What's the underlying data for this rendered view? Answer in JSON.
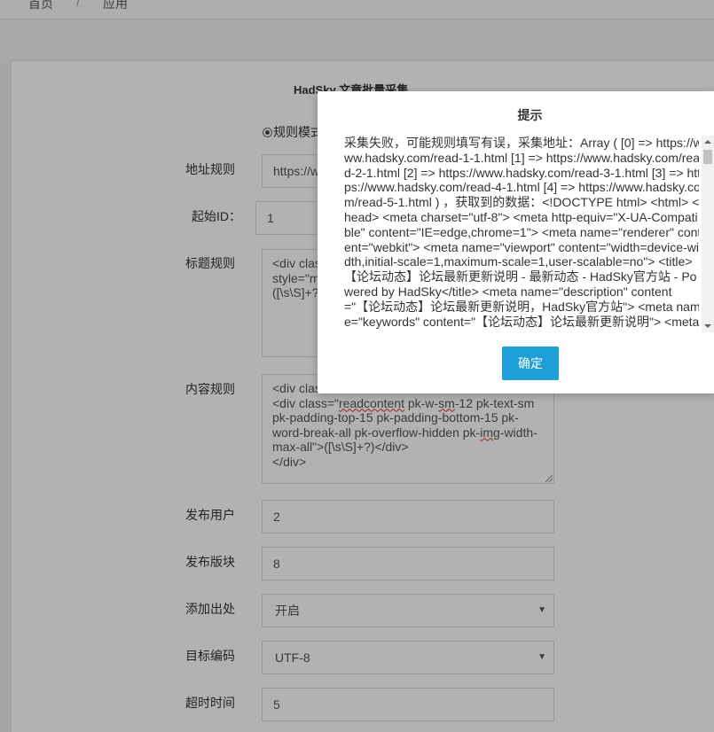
{
  "breadcrumb": {
    "home": "首页",
    "separator": "/",
    "current": "应用"
  },
  "form": {
    "title": "HadSky 文章批量采集",
    "mode_label": "规则模式",
    "url_rule": {
      "label": "地址规则",
      "value": "https://www.hadsky.com/read-{id}-1.html"
    },
    "start_id": {
      "label": "起始ID：",
      "value": "1"
    },
    "title_rule": {
      "label": "标题规则",
      "value": "<div class=\"title\"\nstyle=\"m\n([\\s\\S]+?)"
    },
    "content_rule": {
      "label": "内容规则",
      "line1": "<div class",
      "line2_pre": "<div class=\"",
      "line2_err1": "readcontent",
      "line2_mid": " pk-w-",
      "line2_err2": "sm",
      "line2_post": "-12 pk-text-sm",
      "line3": "pk-padding-top-15 pk-padding-bottom-15 pk-",
      "line4_pre": "word-break-all pk-overflow-hidden pk-",
      "line4_err": "img",
      "line4_post": "-width-",
      "line5": "max-all\">([\\s\\S]+?)</div>",
      "line6": "</div>"
    },
    "publish_user": {
      "label": "发布用户",
      "value": "2"
    },
    "publish_board": {
      "label": "发布版块",
      "value": "8"
    },
    "add_source": {
      "label": "添加出处",
      "value": "开启"
    },
    "target_encoding": {
      "label": "目标编码",
      "value": "UTF-8"
    },
    "timeout": {
      "label": "超时时间",
      "value": "5"
    }
  },
  "dialog": {
    "title": "提示",
    "message": "采集失败，可能规则填写有误，采集地址：Array ( [0] => https://www.hadsky.com/read-1-1.html [1] => https://www.hadsky.com/read-2-1.html [2] => https://www.hadsky.com/read-3-1.html [3] => https://www.hadsky.com/read-4-1.html [4] => https://www.hadsky.com/read-5-1.html ) ，获取到的数据：<!DOCTYPE html> <html> <head> <meta charset=\"utf-8\"> <meta http-equiv=\"X-UA-Compatible\" content=\"IE=edge,chrome=1\"> <meta name=\"renderer\" content=\"webkit\"> <meta name=\"viewport\" content=\"width=device-width,initial-scale=1,maximum-scale=1,user-scalable=no\"> <title>【论坛动态】论坛最新更新说明 - 最新动态 - HadSky官方站 - Powered by HadSky</title> <meta name=\"description\" content=\"【论坛动态】论坛最新更新说明，HadSky官方站\"> <meta name=\"keywords\" content=\"【论坛动态】论坛最新更新说明\"> <meta",
    "confirm_label": "确定"
  },
  "colors": {
    "accent": "#1e9fd8",
    "overlay": "rgba(0,0,0,0.30)"
  }
}
